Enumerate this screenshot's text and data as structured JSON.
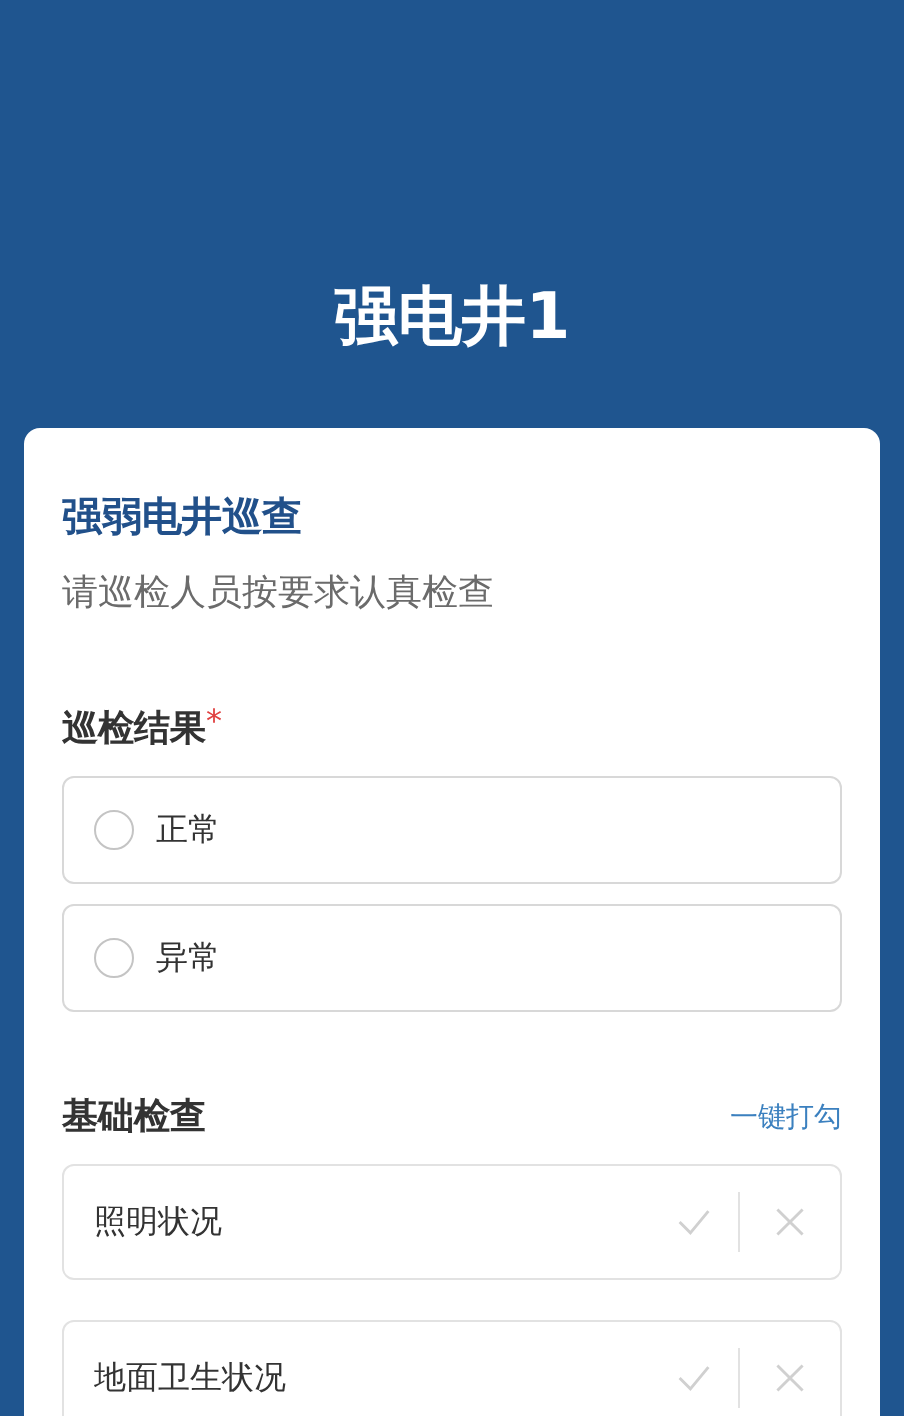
{
  "header": {
    "title": "强电井1"
  },
  "form": {
    "title": "强弱电井巡查",
    "description": "请巡检人员按要求认真检查",
    "result_field": {
      "label": "巡检结果",
      "required_mark": "*",
      "options": [
        {
          "label": "正常",
          "selected": false
        },
        {
          "label": "异常",
          "selected": false
        }
      ]
    },
    "basic_check": {
      "label": "基础检查",
      "check_all_link": "一键打勾",
      "items": [
        {
          "label": "照明状况",
          "passed": false,
          "failed": false
        },
        {
          "label": "地面卫生状况",
          "passed": false,
          "failed": false
        }
      ]
    }
  }
}
